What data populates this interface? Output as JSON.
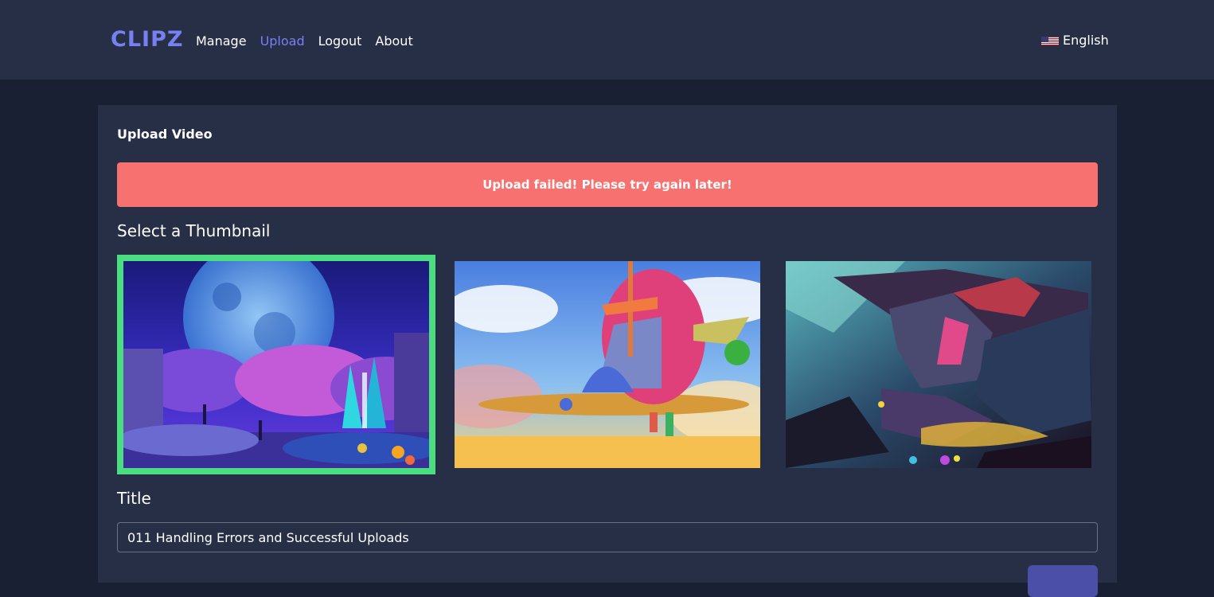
{
  "brand": "CLIPZ",
  "nav": {
    "items": [
      {
        "label": "Manage"
      },
      {
        "label": "Upload"
      },
      {
        "label": "Logout"
      },
      {
        "label": "About"
      }
    ],
    "active": "Upload"
  },
  "language": {
    "label": "English",
    "flag": "us-flag-icon"
  },
  "card": {
    "title": "Upload Video",
    "alert": {
      "message": "Upload failed! Please try again later!",
      "color": "#f87171"
    },
    "thumbnail_section": {
      "label": "Select a Thumbnail",
      "selected_index": 0,
      "thumbnails": [
        {
          "name": "fantasy-moon-landscape-thumbnail"
        },
        {
          "name": "flying-airship-thumbnail"
        },
        {
          "name": "dragon-thumbnail"
        }
      ]
    },
    "title_field": {
      "label": "Title",
      "value": "011 Handling Errors and Successful Uploads"
    },
    "submit": {
      "label": ""
    }
  },
  "colors": {
    "accent": "#7780f0",
    "background": "#1a2033",
    "surface": "#272f47",
    "selected_border": "#4ade80"
  }
}
